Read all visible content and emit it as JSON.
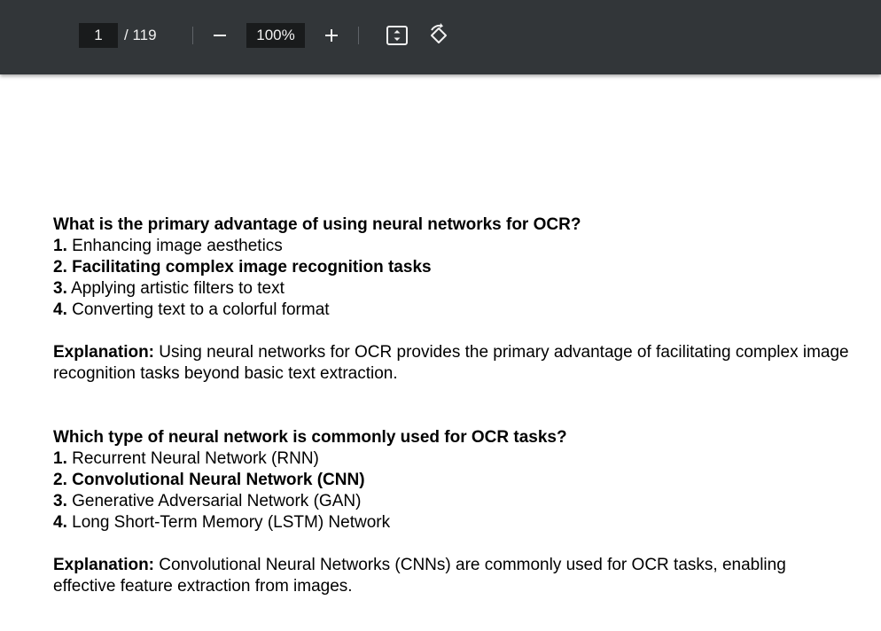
{
  "toolbar": {
    "page_current": "1",
    "page_total": "/ 119",
    "zoom": "100%",
    "icons": [
      "zoom-out-icon",
      "zoom-in-icon",
      "fit-page-icon",
      "rotate-icon"
    ]
  },
  "questions": [
    {
      "question": "What is the primary advantage of using neural networks for OCR?",
      "options": [
        {
          "num": "1.",
          "text": "Enhancing image aesthetics"
        },
        {
          "num": "2.",
          "text": "Facilitating complex image recognition tasks"
        },
        {
          "num": "3.",
          "text": "Applying artistic filters to text"
        },
        {
          "num": "4.",
          "text": "Converting text to a colorful format"
        }
      ],
      "explanation_label": "Explanation:",
      "explanation": "Using neural networks for OCR provides the primary advantage of facilitating complex image recognition tasks beyond basic text extraction."
    },
    {
      "question": "Which type of neural network is commonly used for OCR tasks?",
      "options": [
        {
          "num": "1.",
          "text": "Recurrent Neural Network (RNN)"
        },
        {
          "num": "2.",
          "text": "Convolutional Neural Network (CNN)"
        },
        {
          "num": "3.",
          "text": "Generative Adversarial Network (GAN)"
        },
        {
          "num": "4.",
          "text": "Long Short-Term Memory (LSTM) Network"
        }
      ],
      "explanation_label": "Explanation:",
      "explanation": "Convolutional Neural Networks (CNNs) are commonly used for OCR tasks, enabling effective feature extraction from images."
    }
  ]
}
